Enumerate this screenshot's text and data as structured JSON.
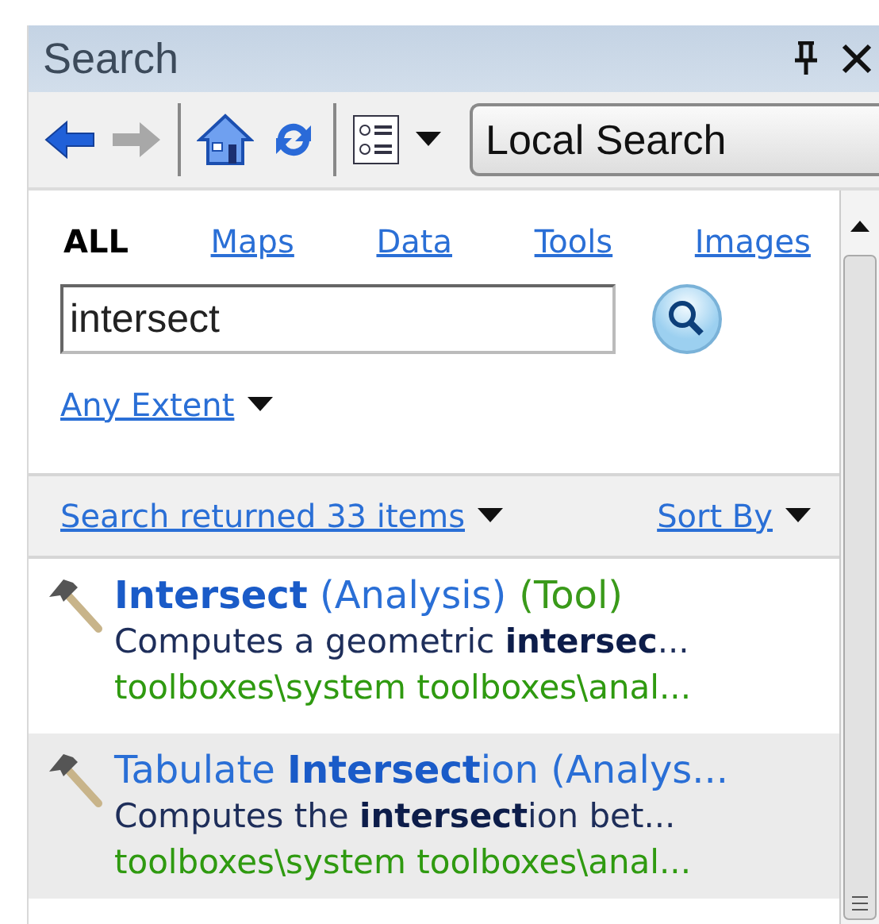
{
  "window": {
    "title": "Search"
  },
  "toolbar": {
    "scope": "Local Search"
  },
  "tabs": [
    {
      "label": "ALL",
      "selected": true
    },
    {
      "label": "Maps",
      "selected": false
    },
    {
      "label": "Data",
      "selected": false
    },
    {
      "label": "Tools",
      "selected": false
    },
    {
      "label": "Images",
      "selected": false
    }
  ],
  "search": {
    "value": "intersect"
  },
  "extent": "Any Extent",
  "results_bar": {
    "summary": "Search returned 33 items",
    "sort": "Sort By"
  },
  "results": [
    {
      "title": "**Intersect** (Analysis)",
      "type": "(Tool)",
      "description": "Computes a geometric **intersec**...",
      "path": "toolboxes\\system toolboxes\\anal...",
      "selected": false
    },
    {
      "title": "Tabulate **Intersect**ion (Analys...",
      "description": "Computes the **intersect**ion bet...",
      "path": "toolboxes\\system toolboxes\\anal...",
      "selected": true
    }
  ]
}
